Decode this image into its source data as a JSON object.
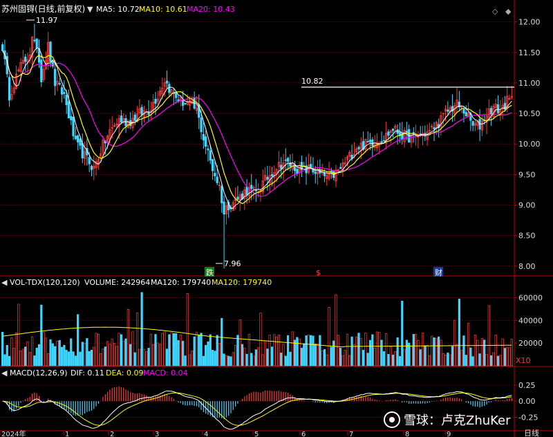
{
  "app": {
    "stock_name": "苏州固锝(日线,前复权)",
    "watermark": "雪球：卢克ZhuKer",
    "right_edge_text": "日线",
    "zoom_label": "X10"
  },
  "colors": {
    "background": "#000000",
    "up": "#ff3b3b",
    "down": "#3fd6ff",
    "ma5": "#ffffff",
    "ma10": "#ffff00",
    "ma20": "#ff00ff",
    "vol_ma": "#ffff00",
    "dif": "#ffffff",
    "dea": "#ffff00",
    "grid": "#7a0000",
    "frame": "#c00000",
    "axis_text": "#dddddd"
  },
  "price_panel": {
    "indicators": [
      {
        "label": "MA5: 10.72",
        "color": "#ffffff"
      },
      {
        "label": "MA10: 10.61",
        "color": "#ffff00"
      },
      {
        "label": "MA20: 10.43",
        "color": "#ff00ff"
      }
    ],
    "high_annotation": "11.97",
    "low_annotation": "7.96",
    "level_line_label": "10.82",
    "markers": [
      {
        "text": "跌",
        "bg": "#1a7a1a",
        "color": "#ffffff"
      },
      {
        "text": "$",
        "bg": "",
        "color": "#ff3b3b"
      },
      {
        "text": "财",
        "bg": "#1a3a8a",
        "color": "#ffffff"
      }
    ],
    "y_ticks": [
      "12.00",
      "11.50",
      "11.00",
      "10.50",
      "10.00",
      "9.50",
      "9.00",
      "8.50",
      "8.00"
    ]
  },
  "volume_panel": {
    "title": "VOL-TDX(120,120)",
    "indicators": [
      {
        "label": "VOLUME: 242964",
        "color": "#ffffff"
      },
      {
        "label": "MA120: 179740",
        "color": "#ffffff"
      },
      {
        "label": "MA120: 179740",
        "color": "#ffff00"
      }
    ],
    "y_ticks": [
      "60000",
      "40000",
      "20000"
    ]
  },
  "macd_panel": {
    "title": "MACD(12,26,9)",
    "indicators": [
      {
        "label": "DIF: 0.11",
        "color": "#ffffff"
      },
      {
        "label": "DEA: 0.09",
        "color": "#ffff00"
      },
      {
        "label": "MACD: 0.04",
        "color": "#ff00ff"
      }
    ],
    "y_ticks": [
      "0.25",
      "0.00",
      "-0.25"
    ]
  },
  "x_axis": {
    "labels": [
      "2024年",
      "1",
      "2",
      "3",
      "4",
      "5",
      "6",
      "7",
      "8",
      "9"
    ]
  },
  "chart_data": {
    "type": "candlestick",
    "yrange": [
      7.85,
      12.2
    ],
    "level_line": 10.82,
    "high_point": 11.97,
    "low_point": 7.96,
    "key_prices": [
      [
        0,
        11.6
      ],
      [
        3,
        10.8
      ],
      [
        7,
        11.2
      ],
      [
        12,
        11.5
      ],
      [
        14,
        11.9
      ],
      [
        17,
        11.1
      ],
      [
        20,
        11.6
      ],
      [
        23,
        11.0
      ],
      [
        27,
        10.8
      ],
      [
        32,
        10.0
      ],
      [
        36,
        9.8
      ],
      [
        40,
        9.6
      ],
      [
        43,
        9.9
      ],
      [
        47,
        10.2
      ],
      [
        51,
        10.4
      ],
      [
        55,
        10.35
      ],
      [
        60,
        10.5
      ],
      [
        64,
        10.55
      ],
      [
        68,
        10.8
      ],
      [
        71,
        11.05
      ],
      [
        74,
        10.85
      ],
      [
        78,
        10.7
      ],
      [
        82,
        10.65
      ],
      [
        85,
        10.55
      ],
      [
        88,
        10.1
      ],
      [
        92,
        9.6
      ],
      [
        95,
        9.3
      ],
      [
        97,
        8.9
      ],
      [
        99,
        9.0
      ],
      [
        103,
        9.1
      ],
      [
        107,
        9.25
      ],
      [
        111,
        9.2
      ],
      [
        115,
        9.4
      ],
      [
        119,
        9.6
      ],
      [
        123,
        9.7
      ],
      [
        127,
        9.65
      ],
      [
        131,
        9.55
      ],
      [
        135,
        9.6
      ],
      [
        139,
        9.5
      ],
      [
        143,
        9.45
      ],
      [
        147,
        9.55
      ],
      [
        151,
        9.75
      ],
      [
        155,
        9.95
      ],
      [
        159,
        10.0
      ],
      [
        163,
        10.05
      ],
      [
        167,
        10.1
      ],
      [
        171,
        10.25
      ],
      [
        175,
        10.15
      ],
      [
        179,
        10.1
      ],
      [
        183,
        10.15
      ],
      [
        187,
        10.2
      ],
      [
        191,
        10.35
      ],
      [
        195,
        10.55
      ],
      [
        199,
        10.65
      ],
      [
        203,
        10.5
      ],
      [
        206,
        10.3
      ],
      [
        209,
        10.3
      ],
      [
        212,
        10.5
      ],
      [
        215,
        10.6
      ],
      [
        218,
        10.55
      ],
      [
        221,
        10.7
      ],
      [
        223,
        10.72
      ]
    ],
    "volume_ma120_level": 17000,
    "volume_ylim": [
      0,
      70000
    ],
    "macd_ylim": [
      -0.45,
      0.4
    ],
    "dif_last": 0.11,
    "dea_last": 0.09,
    "macd_last": 0.04,
    "bars": 224
  }
}
